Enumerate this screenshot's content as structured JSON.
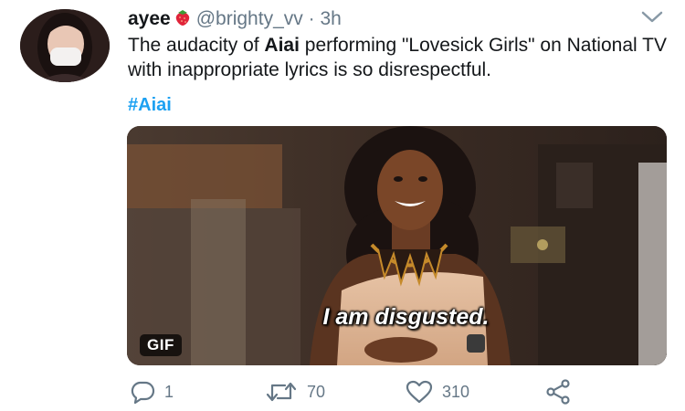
{
  "tweet": {
    "display_name": "ayee",
    "name_emoji": "strawberry-icon",
    "handle": "@brighty_vv",
    "separator": "·",
    "time": "3h",
    "text_part1": "The audacity of ",
    "text_bold": "Aiai",
    "text_part2": " performing \"Lovesick Girls\" on National TV with inappropriate lyrics is so disrespectful.",
    "hashtag": "#Aiai"
  },
  "media": {
    "type": "gif",
    "caption": "I am disgusted.",
    "badge": "GIF"
  },
  "actions": {
    "reply": {
      "icon": "reply-icon",
      "count": "1"
    },
    "retweet": {
      "icon": "retweet-icon",
      "count": "70"
    },
    "like": {
      "icon": "heart-icon",
      "count": "310"
    },
    "share": {
      "icon": "share-icon"
    }
  },
  "colors": {
    "link": "#1da1f2",
    "muted": "#657786",
    "text": "#14171a"
  }
}
